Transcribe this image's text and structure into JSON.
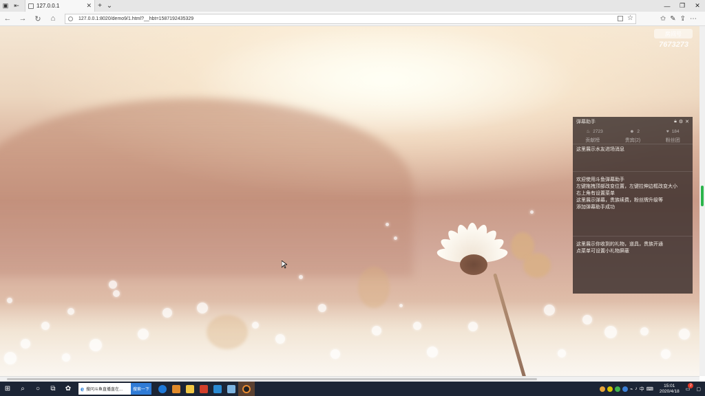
{
  "browser": {
    "tab_title": "127.0.0.1",
    "url": "127.0.0.1:8020/demo9/1.html?__hbt=1587192435329"
  },
  "watermark": {
    "badge_text": "房间号",
    "room_number": "7673273"
  },
  "panel": {
    "title": "弹幕助手",
    "stats": {
      "popularity": "2723",
      "count": "2",
      "likes": "184"
    },
    "tabs": [
      "贡献榜",
      "贵宾(2)",
      "粉丝团"
    ],
    "welcome_area_text": "这里展示水友进场消息",
    "guide_lines": [
      "欢迎使用斗鱼弹幕助手",
      "左键拖拽顶部改变位置，左键拉伸边框改变大小",
      "右上角有设置菜单",
      "这里展示弹幕，贵族续费，粉丝牌升级等",
      "添加弹幕助手成功"
    ],
    "gift_lines": [
      "这里展示你收到的礼物，道具，贵族开通",
      "点菜单可设置小礼物屏蔽"
    ]
  },
  "taskbar": {
    "search_text": "搜问斗鱼直播直在...",
    "search_button": "搜索一下",
    "time": "15:01",
    "date": "2020/4/18",
    "ime": "中",
    "notification_count": "2"
  },
  "colors": {
    "taskbar_bg": "#1c2535",
    "panel_bg": "rgba(50,40,38,0.78)",
    "scroll_thumb": "#2bb54c"
  }
}
